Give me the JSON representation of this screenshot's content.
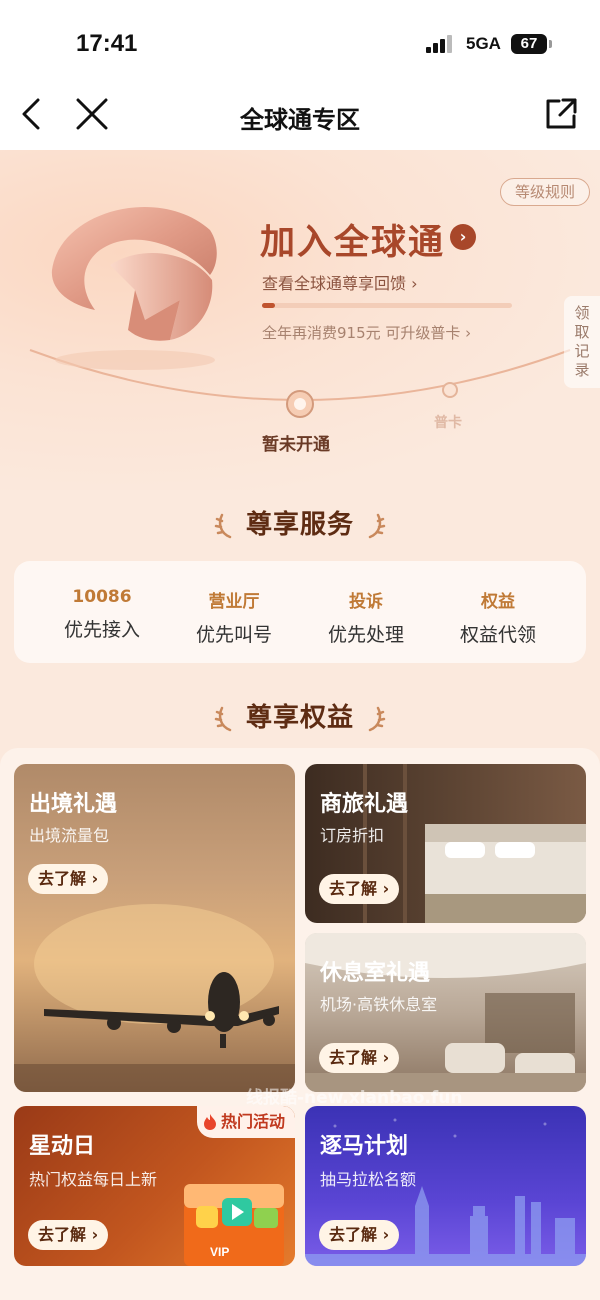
{
  "status_bar": {
    "time": "17:41",
    "network": "5GA",
    "battery": "67"
  },
  "nav": {
    "title": "全球通专区"
  },
  "hero": {
    "rule_button": "等级规则",
    "join_title": "加入全球通",
    "view_link": "查看全球通尊享回馈",
    "progress": 0.05,
    "upgrade_link": "全年再消费915元 可升级普卡",
    "side_tab": "领取记录",
    "levels": {
      "current": "暂未开通",
      "next": "普卡"
    }
  },
  "services_section": {
    "title": "尊享服务",
    "items": [
      {
        "top": "10086",
        "bottom": "优先接入"
      },
      {
        "top": "营业厅",
        "bottom": "优先叫号"
      },
      {
        "top": "投诉",
        "bottom": "优先处理"
      },
      {
        "top": "权益",
        "bottom": "权益代领"
      }
    ]
  },
  "benefits_section": {
    "title": "尊享权益",
    "cards": {
      "outbound": {
        "title": "出境礼遇",
        "subtitle": "出境流量包",
        "button": "去了解"
      },
      "business": {
        "title": "商旅礼遇",
        "subtitle": "订房折扣",
        "button": "去了解"
      },
      "lounge": {
        "title": "休息室礼遇",
        "subtitle": "机场·高铁休息室",
        "button": "去了解"
      },
      "star": {
        "title": "星动日",
        "subtitle": "热门权益每日上新",
        "button": "去了解",
        "tag": "热门活动"
      },
      "marathon": {
        "title": "逐马计划",
        "subtitle": "抽马拉松名额",
        "button": "去了解"
      }
    }
  },
  "watermark": "线报酷-new.xianbao.fun"
}
